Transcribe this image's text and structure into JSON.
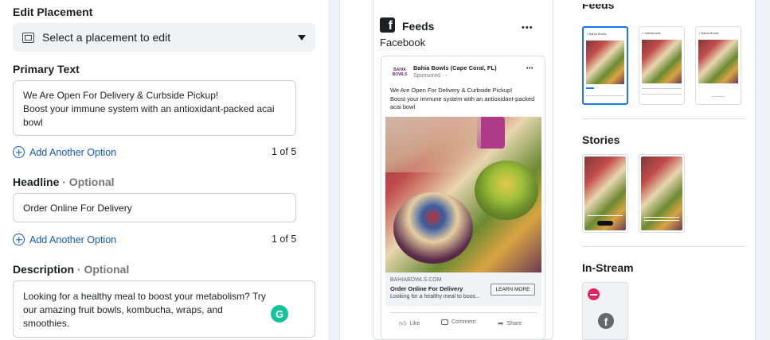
{
  "left": {
    "edit_placement_label": "Edit Placement",
    "placement_select": "Select a placement to edit",
    "primary_text_label": "Primary Text",
    "primary_text": "We Are Open For Delivery & Curbside Pickup!\nBoost your immune system with an antioxidant-packed acai bowl",
    "add_option_1": "Add Another Option",
    "count_1": "1 of 5",
    "headline_label": "Headline",
    "headline_optional": "· Optional",
    "headline_value": "Order Online For Delivery",
    "add_option_2": "Add Another Option",
    "count_2": "1 of 5",
    "description_label": "Description",
    "description_optional": "· Optional",
    "description_value": "Looking for a healthy meal to boost your metabolism? Try our amazing fruit bowls, kombucha, wraps, and smoothies."
  },
  "preview": {
    "title": "Feeds",
    "subtitle": "Facebook",
    "more": "•••",
    "page_name": "Bahia Bowls (Cape Coral, FL)",
    "sponsored": "Sponsored · ",
    "logo_text": "BAHIA BOWLS",
    "post_text": "We Are Open For Delivery & Curbside Pickup!\nBoost your immune system with an antioxidant-packed acai bowl",
    "link_domain": "BAHIABOWLS.COM",
    "link_headline": "Order Online For Delivery",
    "link_desc": "Looking for a healthy meal to boos...",
    "cta": "LEARN MORE",
    "like": "Like",
    "comment": "Comment",
    "share": "Share"
  },
  "right": {
    "feeds_heading": "Feeds",
    "stories_heading": "Stories",
    "instream_heading": "In-Stream"
  }
}
